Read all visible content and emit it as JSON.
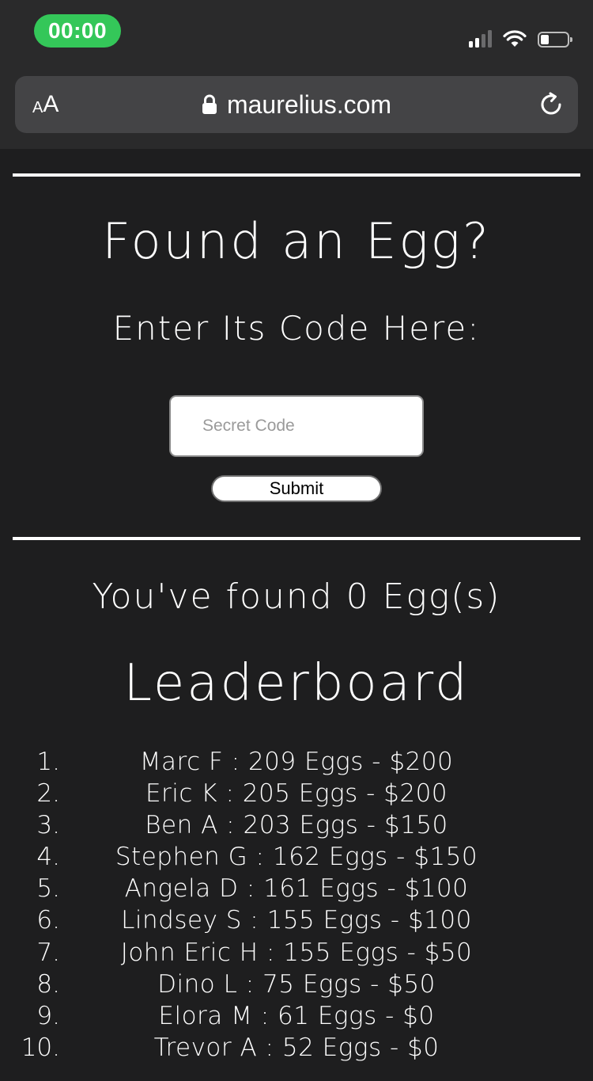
{
  "status_bar": {
    "time": "00:00",
    "signal_icon": "cellular-signal-icon",
    "wifi_icon": "wifi-icon",
    "battery_icon": "battery-icon",
    "battery_level": 0.3
  },
  "browser": {
    "aa_small": "A",
    "aa_big": "A",
    "url": "maurelius.com",
    "lock_icon": "lock-icon",
    "reload_icon": "reload-icon"
  },
  "main": {
    "title": "Found an Egg?",
    "subtitle": "Enter Its Code Here:",
    "code_placeholder": "Secret Code",
    "submit_label": "Submit",
    "found_count": "You've found 0 Egg(s)",
    "leaderboard_title": "Leaderboard"
  },
  "leaderboard": [
    {
      "rank": "1.",
      "entry": "Marc F : 209 Eggs - $200"
    },
    {
      "rank": "2.",
      "entry": "Eric K : 205 Eggs - $200"
    },
    {
      "rank": "3.",
      "entry": "Ben A : 203 Eggs - $150"
    },
    {
      "rank": "4.",
      "entry": "Stephen G : 162 Eggs - $150"
    },
    {
      "rank": "5.",
      "entry": "Angela D : 161 Eggs - $100"
    },
    {
      "rank": "6.",
      "entry": "Lindsey S : 155 Eggs - $100"
    },
    {
      "rank": "7.",
      "entry": "John Eric H : 155 Eggs - $50"
    },
    {
      "rank": "8.",
      "entry": "Dino L : 75 Eggs - $50"
    },
    {
      "rank": "9.",
      "entry": "Elora M : 61 Eggs - $0"
    },
    {
      "rank": "10.",
      "entry": "Trevor A : 52 Eggs - $0"
    }
  ],
  "colors": {
    "page_background": "#1e1e1f",
    "chrome_background": "#2a2a2b",
    "url_bar": "#444446",
    "time_pill": "#34c759",
    "text": "#ffffff"
  }
}
